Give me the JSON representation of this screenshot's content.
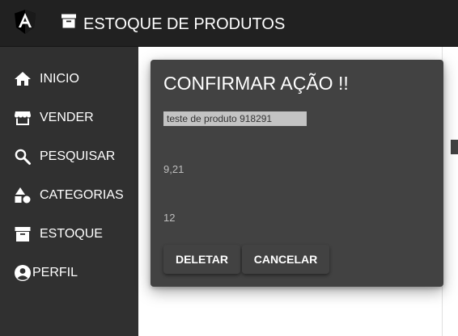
{
  "header": {
    "logo_icon": "angular-logo-icon",
    "title_icon": "archive-box-icon",
    "title": "ESTOQUE DE PRODUTOS"
  },
  "sidebar": {
    "items": [
      {
        "icon": "home-icon",
        "label": "INICIO"
      },
      {
        "icon": "storefront-icon",
        "label": "VENDER"
      },
      {
        "icon": "search-icon",
        "label": "PESQUISAR"
      },
      {
        "icon": "category-shapes-icon",
        "label": "CATEGORIAS"
      },
      {
        "icon": "archive-box-icon",
        "label": "ESTOQUE"
      },
      {
        "icon": "account-circle-icon",
        "label": "PERFIL"
      }
    ]
  },
  "dialog": {
    "title": "CONFIRMAR AÇÃO !!",
    "product_name": "teste de produto 918291",
    "price": "9,21",
    "quantity": "12",
    "delete_label": "DELETAR",
    "cancel_label": "CANCELAR"
  },
  "colors": {
    "toolbar": "#212121",
    "sidebar": "#303030",
    "dialog": "#424242",
    "text": "#ffffff"
  }
}
